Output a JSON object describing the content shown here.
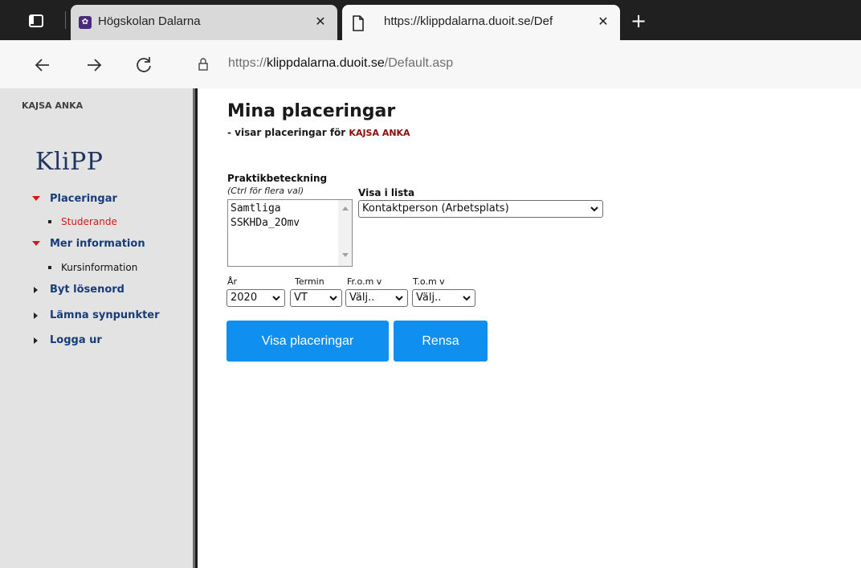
{
  "browser": {
    "tabs": [
      {
        "title": "Högskolan Dalarna",
        "active": false
      },
      {
        "title": "https://klippdalarna.duoit.se/Def",
        "active": true
      }
    ],
    "address": {
      "url_scheme": "https://",
      "url_host": "klippdalarna.duoit.se",
      "url_path": "/Default.asp"
    }
  },
  "sidebar": {
    "user_name": "KAJSA ANKA",
    "logo": "KliPP",
    "menu": [
      {
        "label": "Placeringar",
        "expanded": true,
        "children": [
          {
            "label": "Studerande",
            "active": true
          }
        ]
      },
      {
        "label": "Mer information",
        "expanded": true,
        "children": [
          {
            "label": "Kursinformation",
            "active": false
          }
        ]
      },
      {
        "label": "Byt lösenord",
        "expanded": false
      },
      {
        "label": "Lämna synpunkter",
        "expanded": false
      },
      {
        "label": "Logga ur",
        "expanded": false
      }
    ]
  },
  "main": {
    "title": "Mina placeringar",
    "subtitle_prefix": "- visar placeringar för",
    "subtitle_name": "KAJSA ANKA",
    "form": {
      "praktik_label": "Praktikbeteckning",
      "praktik_hint": "(Ctrl för flera val)",
      "praktik_options": [
        "Samtliga",
        "SSKHDa_2Omv"
      ],
      "visa_label": "Visa i lista",
      "visa_value": "Kontaktperson (Arbetsplats)",
      "ar_label": "År",
      "ar_value": "2020",
      "termin_label": "Termin",
      "termin_value": "VT",
      "from_label": "Fr.o.m v",
      "from_value": "Välj..",
      "tom_label": "T.o.m v",
      "tom_value": "Välj.."
    },
    "buttons": {
      "show": "Visa placeringar",
      "clear": "Rensa"
    }
  },
  "colors": {
    "accent_button": "#0f8ff0",
    "sidebar_link": "#183c78",
    "active_link": "#d21a1a",
    "user_highlight": "#8b0d0d"
  }
}
